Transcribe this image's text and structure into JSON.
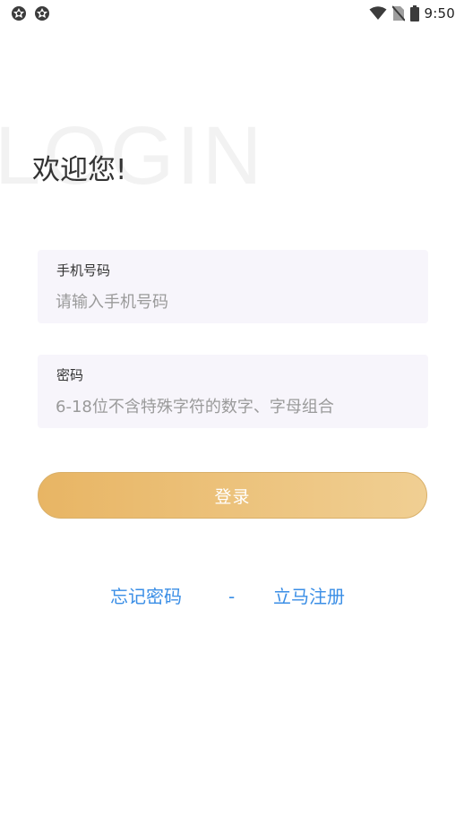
{
  "status_bar": {
    "time": "9:50",
    "icons": [
      "app-notification-icon",
      "app-notification-icon",
      "wifi-icon",
      "no-sim-icon",
      "battery-icon"
    ]
  },
  "watermark": "LOGIN",
  "welcome_title": "欢迎您!",
  "form": {
    "phone": {
      "label": "手机号码",
      "placeholder": "请输入手机号码",
      "value": ""
    },
    "password": {
      "label": "密码",
      "placeholder": "6-18位不含特殊字符的数字、字母组合",
      "value": ""
    },
    "login_label": "登录"
  },
  "links": {
    "forgot_password": "忘记密码",
    "separator": "-",
    "register": "立马注册"
  },
  "colors": {
    "accent_gold_start": "#e8b564",
    "accent_gold_end": "#f0cf93",
    "link_blue": "#3a8ee6",
    "field_background": "#f7f5fb"
  }
}
